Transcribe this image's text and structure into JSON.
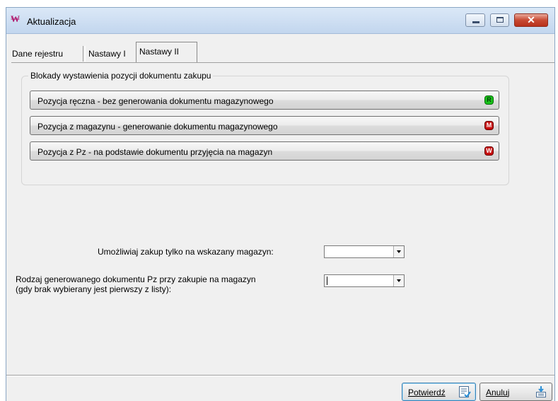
{
  "window": {
    "title": "Aktualizacja",
    "app_icon": "app-icon",
    "controls": {
      "minimize": "minimize-icon",
      "maximize": "maximize-icon",
      "close": "close-icon"
    }
  },
  "tabs": [
    {
      "label": "Dane rejestru",
      "active": false
    },
    {
      "label": "Nastawy I",
      "active": false
    },
    {
      "label": "Nastawy II",
      "active": true
    }
  ],
  "blockade_group": {
    "title": "Blokady wystawienia pozycji dokumentu zakupu",
    "buttons": [
      {
        "label": "Pozycja ręczna - bez generowania dokumentu magazynowego",
        "badge": "R",
        "badge_color": "#19c21b"
      },
      {
        "label": "Pozycja z magazynu - generowanie dokumentu magazynowego",
        "badge": "M",
        "badge_color": "#c80d0d"
      },
      {
        "label": "Pozycja z Pz - na podstawie dokumentu przyjęcia na magazyn",
        "badge": "W",
        "badge_color": "#c80d0d"
      }
    ]
  },
  "form": {
    "warehouse_label": "Umożliwiaj zakup tylko na wskazany magazyn:",
    "warehouse_value": "",
    "doc_type_label_line1": "Rodzaj generowanego dokumentu Pz przy zakupie na magazyn",
    "doc_type_label_line2": "(gdy brak wybierany jest pierwszy z listy):",
    "doc_type_value": ""
  },
  "actions": {
    "confirm_label": "Potwierdź",
    "confirm_icon": "confirm-document-icon",
    "cancel_label": "Anuluj",
    "cancel_icon": "cancel-download-icon"
  }
}
